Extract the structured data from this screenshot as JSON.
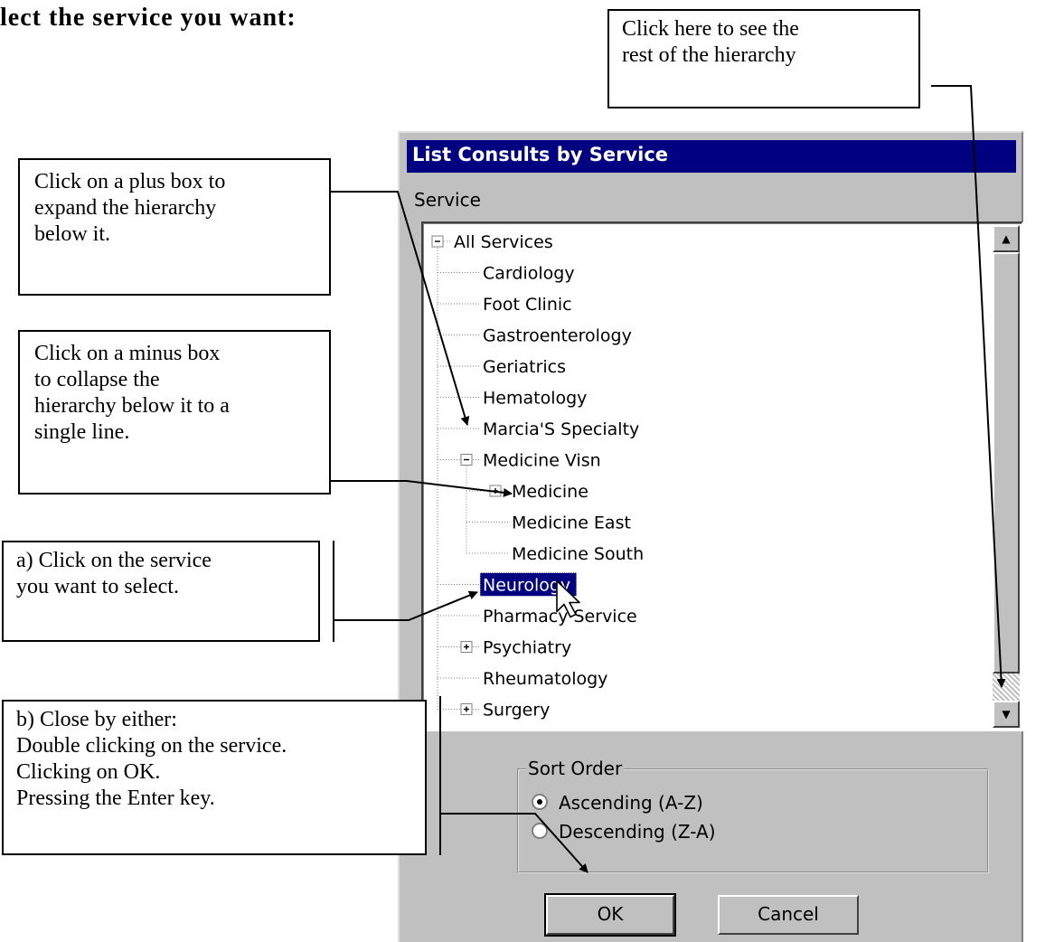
{
  "heading": "lect the service you want:",
  "dialog": {
    "title": "List Consults by Service",
    "service_label": "Service",
    "tree": [
      {
        "label": "All Services",
        "level": 0,
        "expander": "minus"
      },
      {
        "label": "Cardiology",
        "level": 1,
        "expander": "none"
      },
      {
        "label": "Foot Clinic",
        "level": 1,
        "expander": "none"
      },
      {
        "label": "Gastroenterology",
        "level": 1,
        "expander": "none"
      },
      {
        "label": "Geriatrics",
        "level": 1,
        "expander": "none"
      },
      {
        "label": "Hematology",
        "level": 1,
        "expander": "none"
      },
      {
        "label": "Marcia'S Specialty",
        "level": 1,
        "expander": "none"
      },
      {
        "label": "Medicine Visn",
        "level": 1,
        "expander": "minus"
      },
      {
        "label": "Medicine",
        "level": 2,
        "expander": "plus"
      },
      {
        "label": "Medicine East",
        "level": 2,
        "expander": "none"
      },
      {
        "label": "Medicine South",
        "level": 2,
        "expander": "none"
      },
      {
        "label": "Neurology",
        "level": 1,
        "expander": "none",
        "selected": true
      },
      {
        "label": "Pharmacy Service",
        "level": 1,
        "expander": "none"
      },
      {
        "label": "Psychiatry",
        "level": 1,
        "expander": "plus"
      },
      {
        "label": "Rheumatology",
        "level": 1,
        "expander": "none"
      },
      {
        "label": "Surgery",
        "level": 1,
        "expander": "plus"
      }
    ],
    "scroll_up_icon": "▲",
    "scroll_down_icon": "▼",
    "sort_order": {
      "label": "Sort Order",
      "options": [
        "Ascending (A-Z)",
        "Descending (Z-A)"
      ],
      "selected": "Ascending (A-Z)"
    },
    "ok_label": "OK",
    "cancel_label": "Cancel"
  },
  "callouts": {
    "hierarchy": [
      "Click here to see the",
      "rest of the hierarchy"
    ],
    "plus": [
      "Click on a plus box to",
      "expand the hierarchy",
      "below it."
    ],
    "minus": [
      "Click on a minus box",
      "to collapse the",
      "hierarchy below it to a",
      "single line."
    ],
    "select": [
      "a) Click on the service",
      "you want to select."
    ],
    "close": [
      "b) Close by either:",
      "Double clicking on the service.",
      "Clicking on OK.",
      "Pressing the Enter key."
    ]
  },
  "colors": {
    "titlebar": "#000080",
    "dialog_bg": "#c0c0c0",
    "selection": "#000080"
  }
}
